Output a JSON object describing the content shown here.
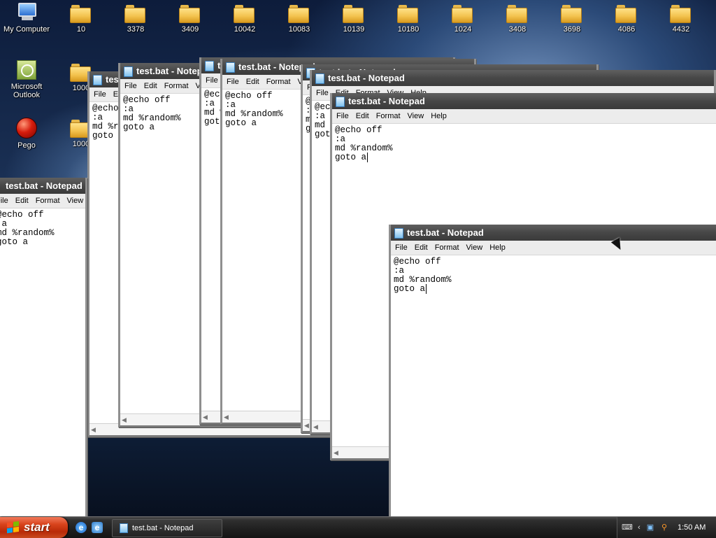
{
  "desktop": {
    "icons": [
      {
        "label": "My Computer",
        "type": "computer"
      },
      {
        "label": "10",
        "type": "folder"
      },
      {
        "label": "3378",
        "type": "folder"
      },
      {
        "label": "3409",
        "type": "folder"
      },
      {
        "label": "10042",
        "type": "folder"
      },
      {
        "label": "10083",
        "type": "folder"
      },
      {
        "label": "10139",
        "type": "folder"
      },
      {
        "label": "10180",
        "type": "folder"
      },
      {
        "label": "1024",
        "type": "folder"
      },
      {
        "label": "3408",
        "type": "folder"
      },
      {
        "label": "3698",
        "type": "folder"
      },
      {
        "label": "4086",
        "type": "folder"
      },
      {
        "label": "4432",
        "type": "folder"
      },
      {
        "label": "Microsoft Outlook",
        "type": "outlook"
      },
      {
        "label": "1000",
        "type": "folder"
      },
      {
        "label": "Pego",
        "type": "app"
      },
      {
        "label": "1000",
        "type": "folder"
      }
    ]
  },
  "notepad": {
    "title": "test.bat - Notepad",
    "menu": [
      "File",
      "Edit",
      "Format",
      "View",
      "Help"
    ],
    "lines": [
      "@echo off",
      ":a",
      "md %random%",
      "goto a"
    ]
  },
  "taskbar": {
    "start_label": "start",
    "task_label": "test.bat - Notepad",
    "clock": "1:50 AM"
  },
  "colors": {
    "start_flag": [
      "#f25022",
      "#7fba00",
      "#00a4ef",
      "#ffb900"
    ]
  }
}
